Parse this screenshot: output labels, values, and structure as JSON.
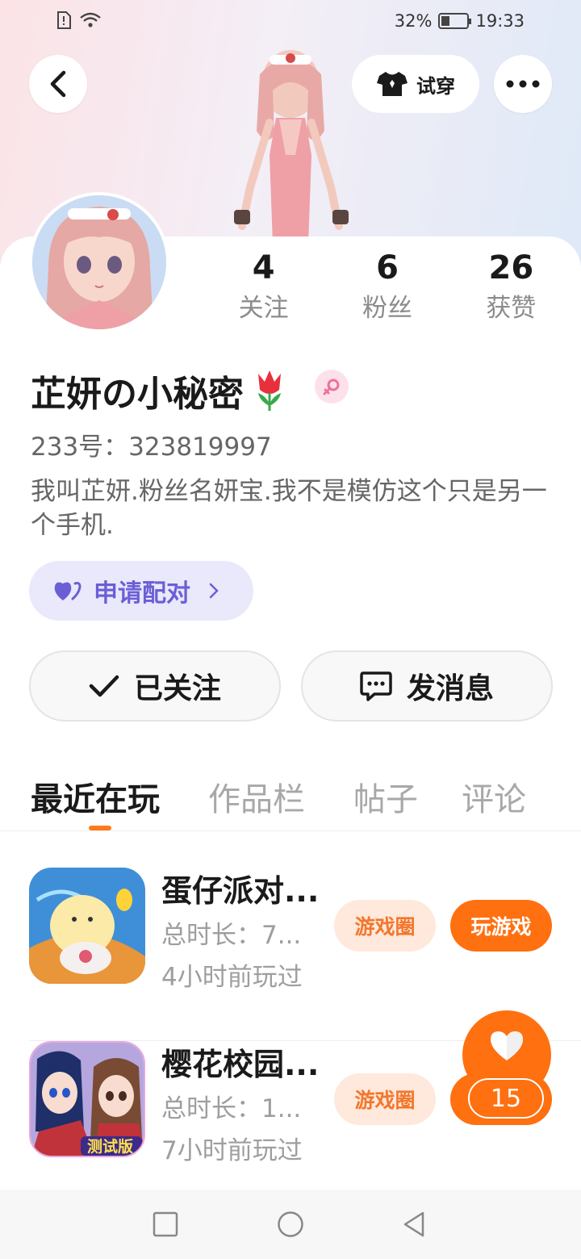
{
  "status_bar": {
    "battery": "32%",
    "battery_level": 0.32,
    "time": "19:33"
  },
  "header": {
    "try_on_label": "试穿"
  },
  "profile": {
    "stats": [
      {
        "value": "4",
        "label": "关注"
      },
      {
        "value": "6",
        "label": "粉丝"
      },
      {
        "value": "26",
        "label": "获赞"
      }
    ],
    "nickname": "芷妍の小秘密",
    "uid": "233号：323819997",
    "bio": "我叫芷妍.粉丝名妍宝.我不是模仿这个只是另一个手机.",
    "match_label": "申请配对",
    "follow_label": "已关注",
    "message_label": "发消息"
  },
  "tabs": [
    "最近在玩",
    "作品栏",
    "帖子",
    "评论"
  ],
  "games": [
    {
      "name": "蛋仔派对...",
      "duration": "总时长：7...",
      "last_played": "4小时前玩过",
      "circle_label": "游戏圈",
      "play_label": "玩游戏"
    },
    {
      "name": "樱花校园...",
      "duration": "总时长：1...",
      "last_played": "7小时前玩过",
      "circle_label": "游戏圈",
      "badge": "测试版"
    }
  ],
  "like_count": "15",
  "colors": {
    "accent": "#ff7010",
    "match": "#6b5fd6"
  }
}
